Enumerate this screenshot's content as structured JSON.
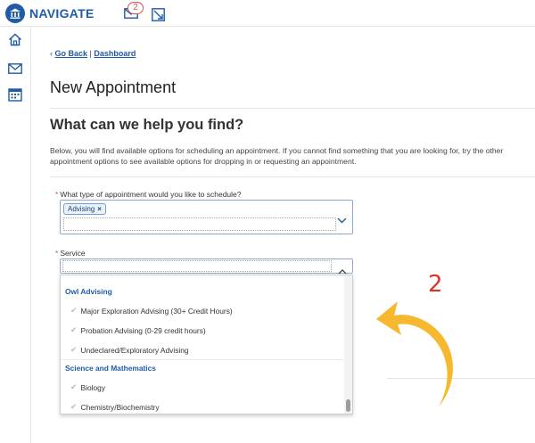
{
  "app": {
    "name": "NAVIGATE",
    "notification_count": "2"
  },
  "breadcrumb": {
    "back_label": "Go Back",
    "separator": "|",
    "dashboard_label": "Dashboard"
  },
  "page": {
    "title": "New Appointment",
    "section_title": "What can we help you find?",
    "description": "Below, you will find available options for scheduling an appointment. If you cannot find something that you are looking for, try the other appointment options to see available options for dropping in or requesting an appointment."
  },
  "form": {
    "appointment_type": {
      "required_mark": "*",
      "label": "What type of appointment would you like to schedule?",
      "selected_chip": "Advising",
      "chip_remove": "×"
    },
    "service": {
      "required_mark": "*",
      "label": "Service",
      "groups": [
        {
          "name": "Owl Advising",
          "options": [
            "Major Exploration Advising (30+ Credit Hours)",
            "Probation Advising (0-29 credit hours)",
            "Undeclared/Exploratory Advising"
          ]
        },
        {
          "name": "Science and Mathematics",
          "options": [
            "Biology",
            "Chemistry/Biochemistry"
          ]
        }
      ]
    }
  },
  "annotation": {
    "step_number": "2",
    "color": "#e0302a",
    "arrow_color": "#f5b82e"
  },
  "colors": {
    "brand": "#1f5ba8",
    "required": "#d9534f"
  },
  "icons": {
    "logo": "university-columns-icon",
    "mail": "envelope-icon",
    "calendar": "calendar-icon",
    "home": "home-icon"
  }
}
